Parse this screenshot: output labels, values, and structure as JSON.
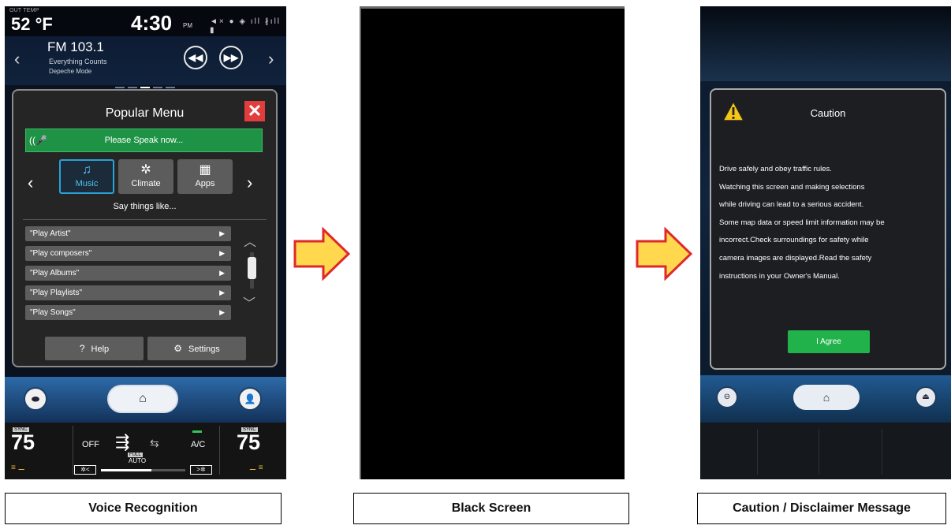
{
  "panel1": {
    "status": {
      "out_temp_label": "OUT TEMP",
      "out_temp": "52 °F",
      "time": "4:30",
      "ampm": "PM",
      "icons": "◄× ● ◈ ıll ∦ıll ▮"
    },
    "radio": {
      "station": "FM 103.1",
      "song": "Everything Counts",
      "artist": "Depeche Mode",
      "prev_chevron": "‹",
      "next_chevron": "›",
      "rewind": "◀◀",
      "forward": "▶▶"
    },
    "popup": {
      "title": "Popular Menu",
      "close": "✕",
      "speak": "Please Speak now...",
      "mic": "((🎤",
      "categories": [
        {
          "icon": "♫",
          "label": "Music"
        },
        {
          "icon": "✲",
          "label": "Climate"
        },
        {
          "icon": "▦",
          "label": "Apps"
        }
      ],
      "cat_prev": "‹",
      "cat_next": "›",
      "say_things": "Say things like...",
      "items": [
        "\"Play Artist\"",
        "\"Play composers\"",
        "\"Play Albums\"",
        "\"Play Playlists\"",
        "\"Play Songs\""
      ],
      "item_arrow": "▶",
      "scroll_up": "︿",
      "scroll_down": "﹀",
      "help_icon": "?",
      "help": "Help",
      "settings_icon": "⚙",
      "settings": "Settings"
    },
    "nav": {
      "car_icon": "⬬",
      "home_icon": "⌂",
      "profile_icon": "👤"
    },
    "climate": {
      "sync": "SYNC",
      "left_temp": "75",
      "right_temp": "75",
      "off": "OFF",
      "fan_icon": "⇶",
      "car_icon": "⇆",
      "full": "FULL",
      "auto": "AUTO",
      "ac": "A/C",
      "fan_min": "✲<",
      "fan_max": ">✲",
      "fan_level": 0.6,
      "seat_left": "≡ ⚊",
      "seat_right": "⚊ ≡"
    }
  },
  "panel3": {
    "title": "Caution",
    "lines": [
      "Drive safely and obey traffic rules.",
      "Watching this screen and making selections",
      "while driving can lead to a serious accident.",
      "Some map data or speed limit information may be",
      "incorrect.Check surroundings for safety while",
      "camera images are displayed.Read the safety",
      "instructions in your Owner's Manual."
    ],
    "agree": "I Agree",
    "nav_home_icon": "⌂",
    "nav_left_icon": "⊖",
    "nav_right_icon": "⏏"
  },
  "captions": {
    "voice": "Voice Recognition",
    "black": "Black Screen",
    "caution": "Caution / Disclaimer Message"
  },
  "colors": {
    "arrow_fill": "#ffd84d",
    "arrow_stroke": "#e0282b",
    "speak_green": "#1e9346",
    "close_red": "#e23d3d",
    "agree_green": "#22b24c",
    "music_accent": "#2aa3d8"
  }
}
